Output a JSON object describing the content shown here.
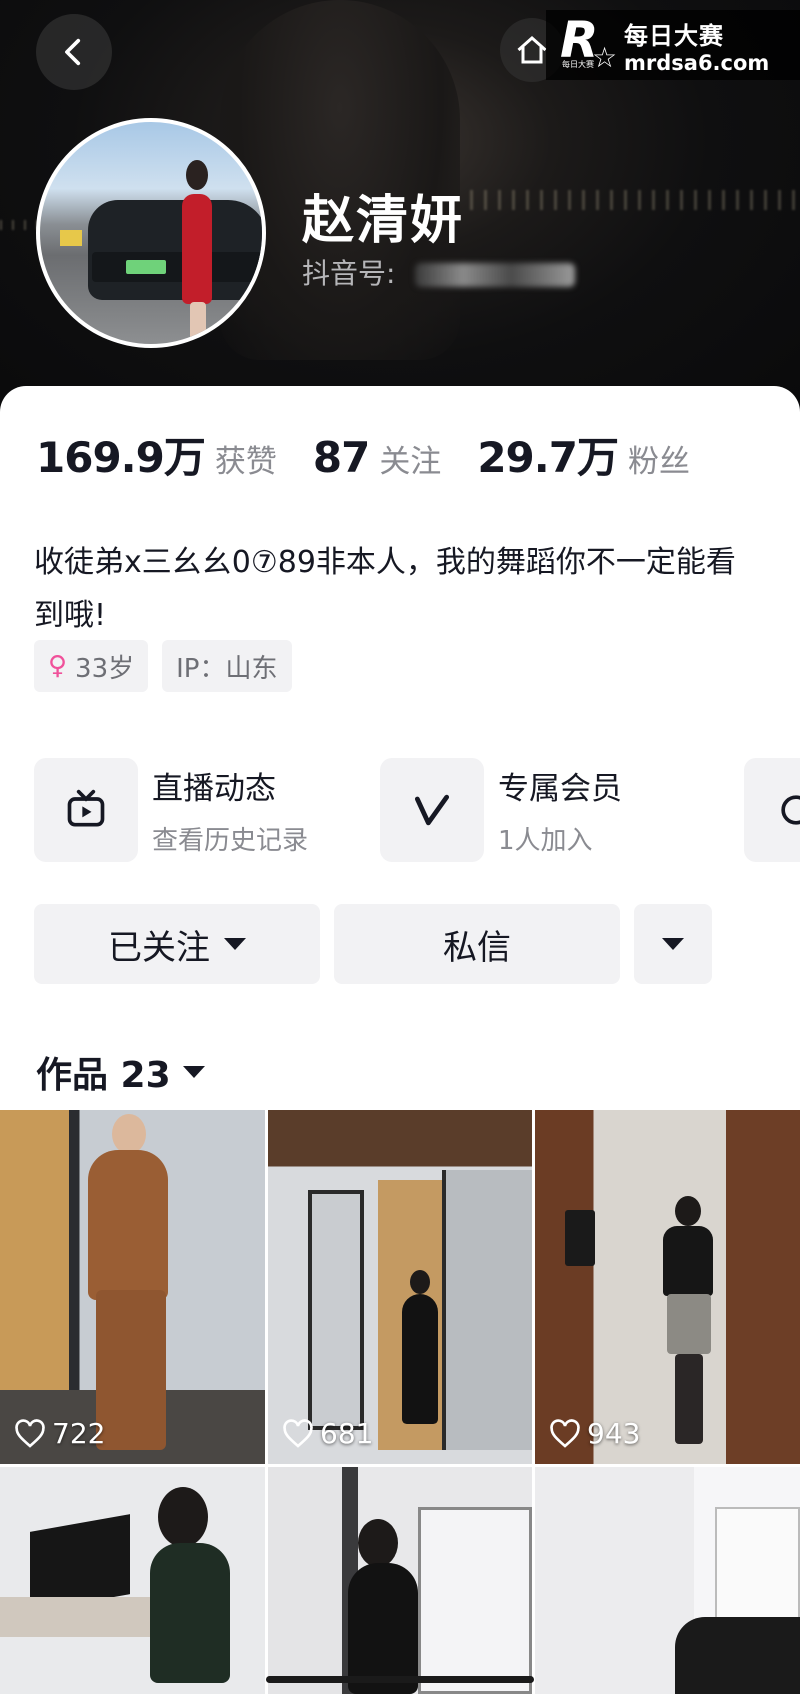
{
  "header": {
    "back_icon": "chevron-left-icon",
    "home_icon": "home-icon",
    "watermark": {
      "line1": "每日大赛",
      "line2": "mrdsa6.com",
      "logo_text": "R",
      "logo_sub": "每日大赛"
    }
  },
  "profile": {
    "nickname": "赵清妍",
    "douyin_id_label": "抖音号:"
  },
  "stats": [
    {
      "value": "169.9万",
      "label": "获赞"
    },
    {
      "value": "87",
      "label": "关注"
    },
    {
      "value": "29.7万",
      "label": "粉丝"
    }
  ],
  "bio": "收徒弟x三幺幺0⑦89非本人，我的舞蹈你不一定能看到哦!",
  "tags": {
    "age": {
      "icon": "female-icon",
      "text": "33岁"
    },
    "ip": "IP：山东"
  },
  "features": [
    {
      "icon": "tv-icon",
      "title": "直播动态",
      "subtitle": "查看历史记录"
    },
    {
      "icon": "v-icon",
      "title": "专属会员",
      "subtitle": "1人加入"
    }
  ],
  "actions": {
    "follow": "已关注",
    "message": "私信"
  },
  "works": {
    "title": "作品 23",
    "items": [
      {
        "likes": "722"
      },
      {
        "likes": "681"
      },
      {
        "likes": "943"
      },
      {
        "likes": ""
      },
      {
        "likes": ""
      },
      {
        "likes": ""
      }
    ]
  },
  "colors": {
    "accent_pink": "#f0519a",
    "text_primary": "#161823",
    "text_secondary": "#8a8b91",
    "chip_bg": "#f2f2f4"
  }
}
